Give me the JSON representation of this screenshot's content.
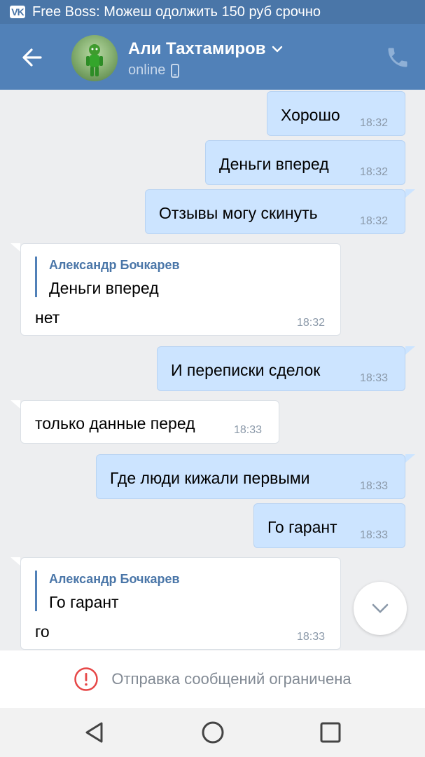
{
  "status_bar": {
    "notification": "Free Boss: Можеш одолжить 150 руб срочно"
  },
  "header": {
    "name": "Али Тахтамиров",
    "status": "online"
  },
  "messages": [
    {
      "dir": "out",
      "text": "Хорошо",
      "time": "18:32"
    },
    {
      "dir": "out",
      "text": "Деньги вперед",
      "time": "18:32"
    },
    {
      "dir": "out",
      "text": "Отзывы могу скинуть",
      "time": "18:32"
    },
    {
      "dir": "in",
      "quote_author": "Александр Бочкарев",
      "quote_text": "Деньги вперед",
      "text": "нет",
      "time": "18:32"
    },
    {
      "dir": "out",
      "text": "И переписки сделок",
      "time": "18:33"
    },
    {
      "dir": "in",
      "text": "только данные перед",
      "time": "18:33"
    },
    {
      "dir": "out",
      "text": "Где люди кижали первыми",
      "time": "18:33"
    },
    {
      "dir": "out",
      "text": "Го гарант",
      "time": "18:33"
    },
    {
      "dir": "in",
      "quote_author": "Александр Бочкарев",
      "quote_text": "Го гарант",
      "text": "го",
      "time": "18:33"
    }
  ],
  "restriction": {
    "text": "Отправка сообщений ограничена"
  },
  "icons": {
    "status": "vk-logo-icon",
    "back": "arrow-left-icon",
    "phone": "phone-icon",
    "device": "mobile-device-icon",
    "dropdown": "chevron-down-icon",
    "scroll": "chevron-down-icon",
    "warning": "exclamation-circle-icon",
    "nav": [
      "back-triangle-icon",
      "home-circle-icon",
      "recents-square-icon"
    ]
  },
  "colors": {
    "header": "#5181b8",
    "outgoing_bubble": "#cce4ff",
    "incoming_bubble": "#ffffff",
    "accent": "#4a76a8",
    "warning": "#e64646"
  }
}
